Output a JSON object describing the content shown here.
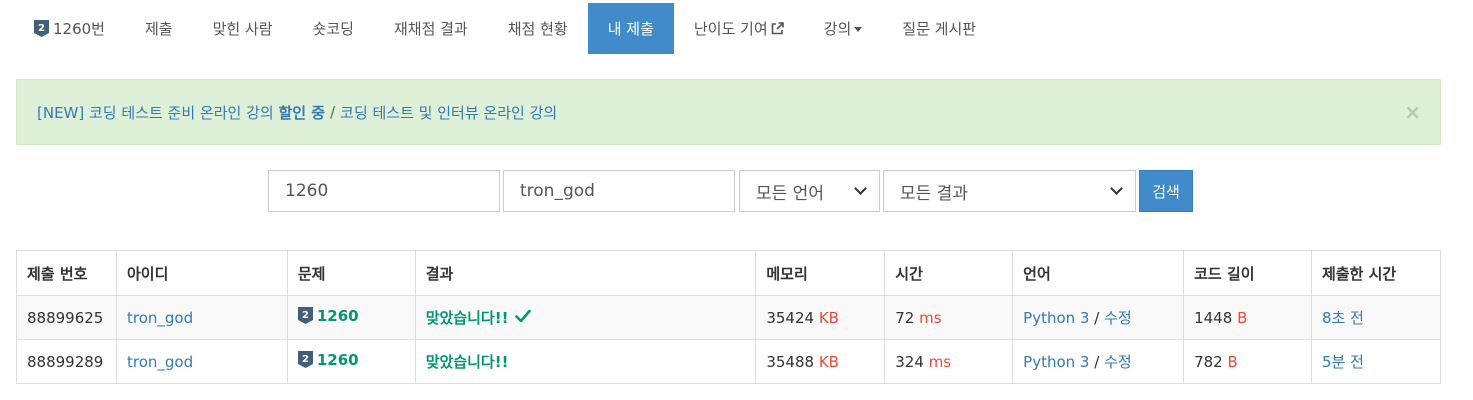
{
  "tabs": [
    {
      "label": "1260번"
    },
    {
      "label": "제출"
    },
    {
      "label": "맞힌 사람"
    },
    {
      "label": "숏코딩"
    },
    {
      "label": "재채점 결과"
    },
    {
      "label": "채점 현황"
    },
    {
      "label": "내 제출"
    },
    {
      "label": "난이도 기여"
    },
    {
      "label": "강의"
    },
    {
      "label": "질문 게시판"
    }
  ],
  "active_tab": "내 제출",
  "tier_badge_number": "2",
  "alert": {
    "prefix": "[NEW] 코딩 테스트 준비 온라인 강의 ",
    "bold": "할인 중",
    "separator": "/",
    "second": "코딩 테스트 및 인터뷰 온라인 강의",
    "close": "×"
  },
  "search": {
    "problem_id": "1260",
    "user_id": "tron_god",
    "language": "모든 언어",
    "result": "모든 결과",
    "button": "검색"
  },
  "table": {
    "headers": [
      "제출 번호",
      "아이디",
      "문제",
      "결과",
      "메모리",
      "시간",
      "언어",
      "코드 길이",
      "제출한 시간"
    ],
    "rows": [
      {
        "id": "88899625",
        "user": "tron_god",
        "problem": "1260",
        "result": "맞았습니다!!",
        "memory": "35424",
        "memory_unit": "KB",
        "time": "72",
        "time_unit": "ms",
        "language": "Python 3",
        "edit": "수정",
        "code_length": "1448",
        "code_unit": "B",
        "submitted": "8초 전"
      },
      {
        "id": "88899289",
        "user": "tron_god",
        "problem": "1260",
        "result": "맞았습니다!!",
        "memory": "35488",
        "memory_unit": "KB",
        "time": "324",
        "time_unit": "ms",
        "language": "Python 3",
        "edit": "수정",
        "code_length": "782",
        "code_unit": "B",
        "submitted": "5분 전"
      }
    ]
  },
  "colors": {
    "accent": "#428bca",
    "success_bg": "#dff0d8",
    "accepted": "#009874",
    "unit": "#e74c3c",
    "link": "#337ab7"
  }
}
